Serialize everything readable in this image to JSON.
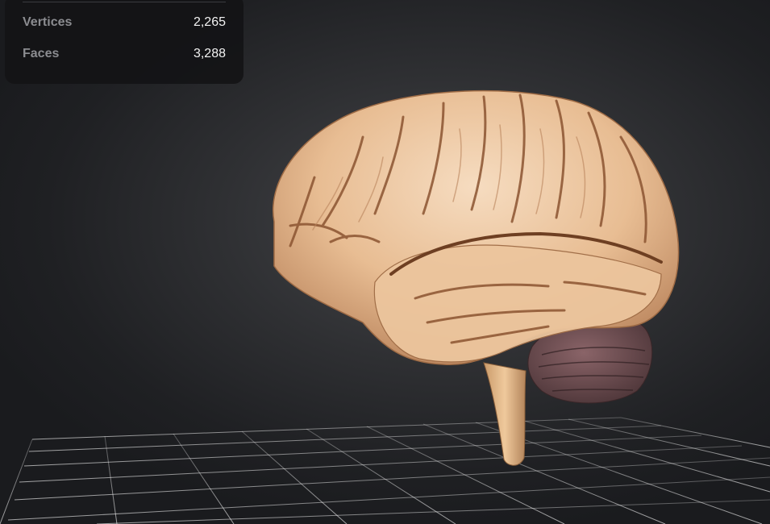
{
  "viewer": {
    "background_color": "#2f3033",
    "model_name_icon": "brain-model"
  },
  "stats": {
    "rows": [
      {
        "label": "Vertices",
        "value": "2,265"
      },
      {
        "label": "Faces",
        "value": "3,288"
      }
    ]
  }
}
